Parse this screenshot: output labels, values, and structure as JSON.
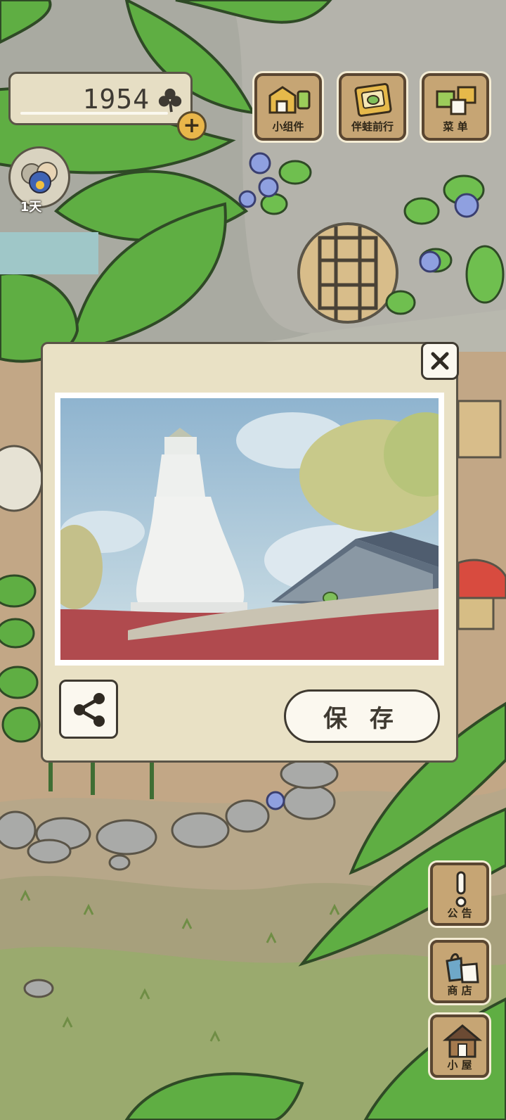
{
  "status": {
    "clover_count": "1954",
    "days": "1天"
  },
  "top_buttons": {
    "widget": "小组件",
    "travel": "伴蛙前行",
    "menu": "菜 单"
  },
  "popup": {
    "save_label": "保 存"
  },
  "side_buttons": {
    "notice": "公 告",
    "shop": "商 店",
    "house": "小 屋"
  },
  "colors": {
    "panel": "#e9e1c5",
    "panel_border": "#5a5447",
    "wood": "#c6a574",
    "button_fill": "#fbf8ef",
    "leaf": "#5fae43"
  }
}
